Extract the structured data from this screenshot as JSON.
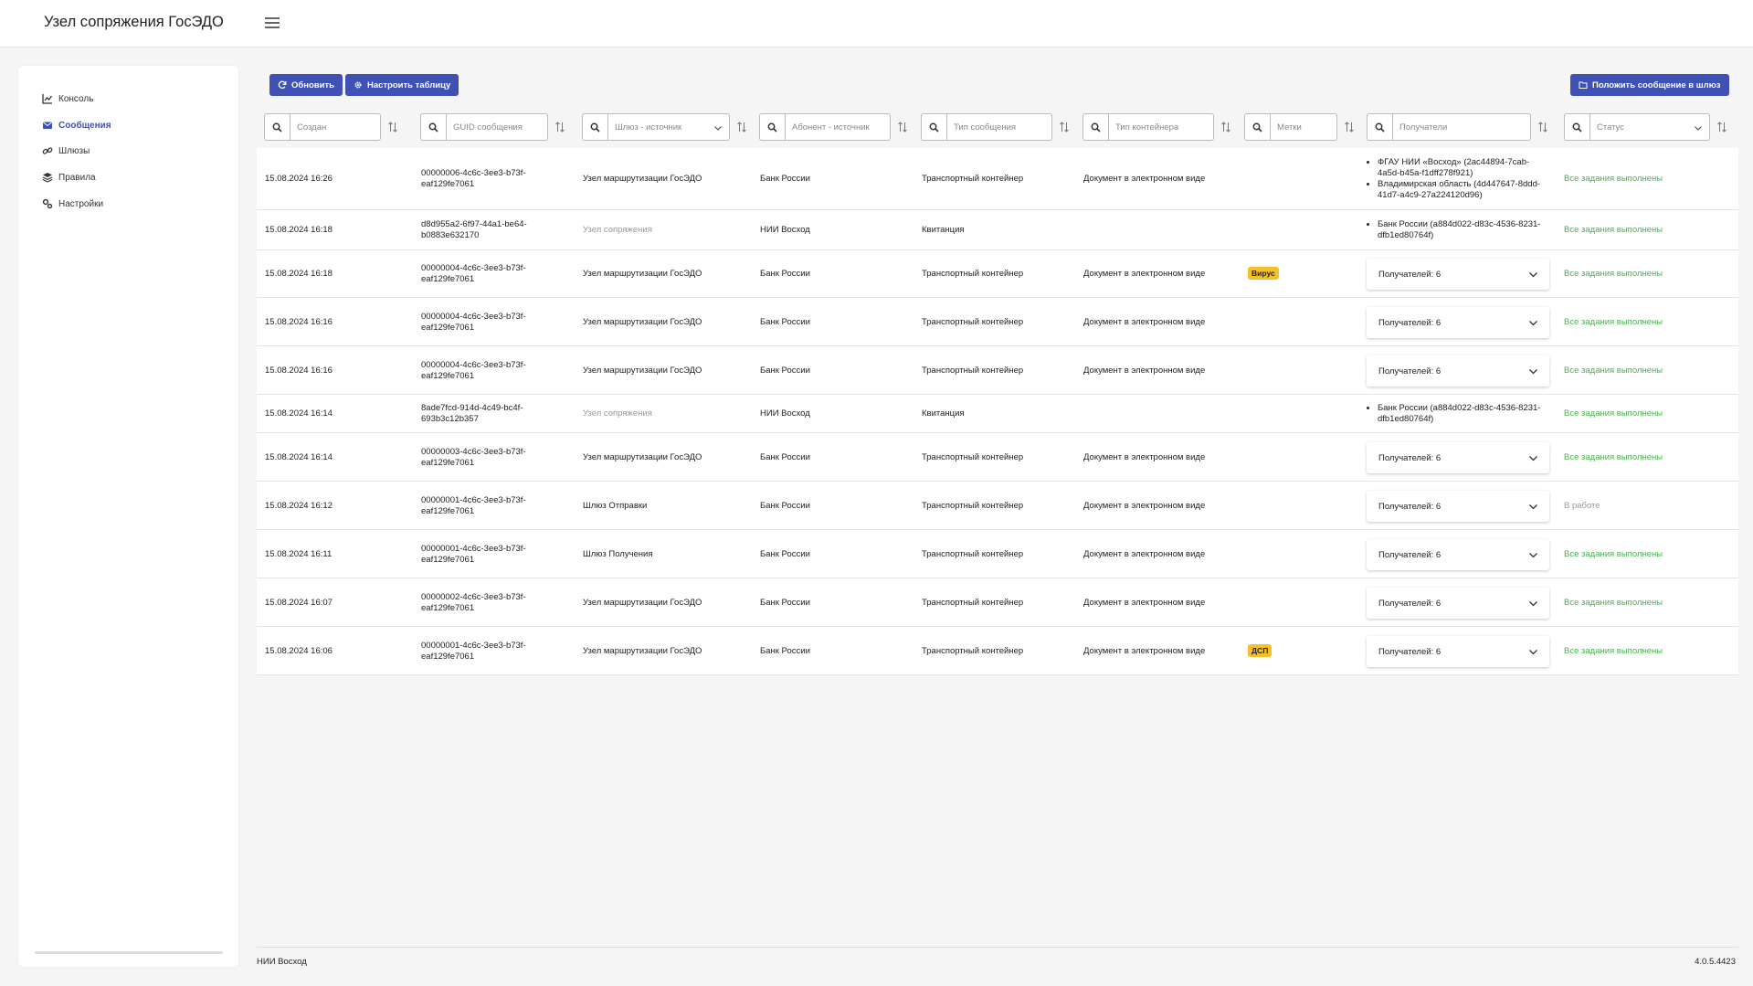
{
  "app_title": "Узел сопряжения ГосЭДО",
  "sidebar": {
    "items": [
      {
        "label": "Консоль",
        "icon": "chart-icon"
      },
      {
        "label": "Сообщения",
        "icon": "envelope-icon"
      },
      {
        "label": "Шлюзы",
        "icon": "link-icon"
      },
      {
        "label": "Правила",
        "icon": "layers-icon"
      },
      {
        "label": "Настройки",
        "icon": "gears-icon"
      }
    ]
  },
  "toolbar": {
    "refresh_label": "Обновить",
    "configure_label": "Настроить таблицу",
    "put_message_label": "Положить сообщение в шлюз"
  },
  "filters": {
    "created": "Создан",
    "guid": "GUID сообщения",
    "gateway": "Шлюз - источник",
    "subscriber": "Абонент - источник",
    "msg_type": "Тип сообщения",
    "container_type": "Тип контейнера",
    "tags": "Метки",
    "recipients": "Получатели",
    "status": "Статус"
  },
  "rows": [
    {
      "created": "15.08.2024 16:26",
      "guid1": "00000006-4c6c-3ee3-b73f-",
      "guid2": "eaf129fe7061",
      "gateway": "Узел маршрутизации ГосЭДО",
      "subscriber": "Банк России",
      "type": "Транспортный контейнер",
      "container": "Документ в электронном виде",
      "tag": "",
      "recipients": [
        "ФГАУ НИИ «Восход» (2ac44894-7cab-4a5d-b45a-f1dff278f921)",
        "Владимирская область (4d447647-8ddd-41d7-a4c9-27a224120d96)"
      ],
      "recipients_count": "",
      "status": "Все задания выполнены"
    },
    {
      "created": "15.08.2024 16:18",
      "guid1": "d8d955a2-6f97-44a1-be64-",
      "guid2": "b0883e632170",
      "gateway": "Узел сопряжения",
      "subscriber": "НИИ Восход",
      "type": "Квитанция",
      "container": "",
      "tag": "",
      "recipients": [
        "Банк России (a884d022-d83c-4536-8231-dfb1ed80764f)"
      ],
      "recipients_count": "",
      "status": "Все задания выполнены"
    },
    {
      "created": "15.08.2024 16:18",
      "guid1": "00000004-4c6c-3ee3-b73f-",
      "guid2": "eaf129fe7061",
      "gateway": "Узел маршрутизации ГосЭДО",
      "subscriber": "Банк России",
      "type": "Транспортный контейнер",
      "container": "Документ в электронном виде",
      "tag": "Вирус",
      "recipients": [],
      "recipients_count": "Получателей: 6",
      "status": "Все задания выполнены"
    },
    {
      "created": "15.08.2024 16:16",
      "guid1": "00000004-4c6c-3ee3-b73f-",
      "guid2": "eaf129fe7061",
      "gateway": "Узел маршрутизации ГосЭДО",
      "subscriber": "Банк России",
      "type": "Транспортный контейнер",
      "container": "Документ в электронном виде",
      "tag": "",
      "recipients": [],
      "recipients_count": "Получателей: 6",
      "status": "Все задания выполнены"
    },
    {
      "created": "15.08.2024 16:16",
      "guid1": "00000004-4c6c-3ee3-b73f-",
      "guid2": "eaf129fe7061",
      "gateway": "Узел маршрутизации ГосЭДО",
      "subscriber": "Банк России",
      "type": "Транспортный контейнер",
      "container": "Документ в электронном виде",
      "tag": "",
      "recipients": [],
      "recipients_count": "Получателей: 6",
      "status": "Все задания выполнены"
    },
    {
      "created": "15.08.2024 16:14",
      "guid1": "8ade7fcd-914d-4c49-bc4f-",
      "guid2": "693b3c12b357",
      "gateway": "Узел сопряжения",
      "subscriber": "НИИ Восход",
      "type": "Квитанция",
      "container": "",
      "tag": "",
      "recipients": [
        "Банк России (a884d022-d83c-4536-8231-dfb1ed80764f)"
      ],
      "recipients_count": "",
      "status": "Все задания выполнены"
    },
    {
      "created": "15.08.2024 16:14",
      "guid1": "00000003-4c6c-3ee3-b73f-",
      "guid2": "eaf129fe7061",
      "gateway": "Узел маршрутизации ГосЭДО",
      "subscriber": "Банк России",
      "type": "Транспортный контейнер",
      "container": "Документ в электронном виде",
      "tag": "",
      "recipients": [],
      "recipients_count": "Получателей: 6",
      "status": "Все задания выполнены"
    },
    {
      "created": "15.08.2024 16:12",
      "guid1": "00000001-4c6c-3ee3-b73f-",
      "guid2": "eaf129fe7061",
      "gateway": "Шлюз Отправки",
      "subscriber": "Банк России",
      "type": "Транспортный контейнер",
      "container": "Документ в электронном виде",
      "tag": "",
      "recipients": [],
      "recipients_count": "Получателей: 6",
      "status": "В работе"
    },
    {
      "created": "15.08.2024 16:11",
      "guid1": "00000001-4c6c-3ee3-b73f-",
      "guid2": "eaf129fe7061",
      "gateway": "Шлюз Получения",
      "subscriber": "Банк России",
      "type": "Транспортный контейнер",
      "container": "Документ в электронном виде",
      "tag": "",
      "recipients": [],
      "recipients_count": "Получателей: 6",
      "status": "Все задания выполнены"
    },
    {
      "created": "15.08.2024 16:07",
      "guid1": "00000002-4c6c-3ee3-b73f-",
      "guid2": "eaf129fe7061",
      "gateway": "Узел маршрутизации ГосЭДО",
      "subscriber": "Банк России",
      "type": "Транспортный контейнер",
      "container": "Документ в электронном виде",
      "tag": "",
      "recipients": [],
      "recipients_count": "Получателей: 6",
      "status": "Все задания выполнены"
    },
    {
      "created": "15.08.2024 16:06",
      "guid1": "00000001-4c6c-3ee3-b73f-",
      "guid2": "eaf129fe7061",
      "gateway": "Узел маршрутизации ГосЭДО",
      "subscriber": "Банк России",
      "type": "Транспортный контейнер",
      "container": "Документ в электронном виде",
      "tag": "ДСП",
      "recipients": [],
      "recipients_count": "Получателей: 6",
      "status": "Все задания выполнены"
    }
  ],
  "footer": {
    "org": "НИИ Восход",
    "version": "4.0.5.4423"
  },
  "colors": {
    "accent": "#3f51b5",
    "status_ok": "#4caf50",
    "badge": "#f6c026"
  }
}
